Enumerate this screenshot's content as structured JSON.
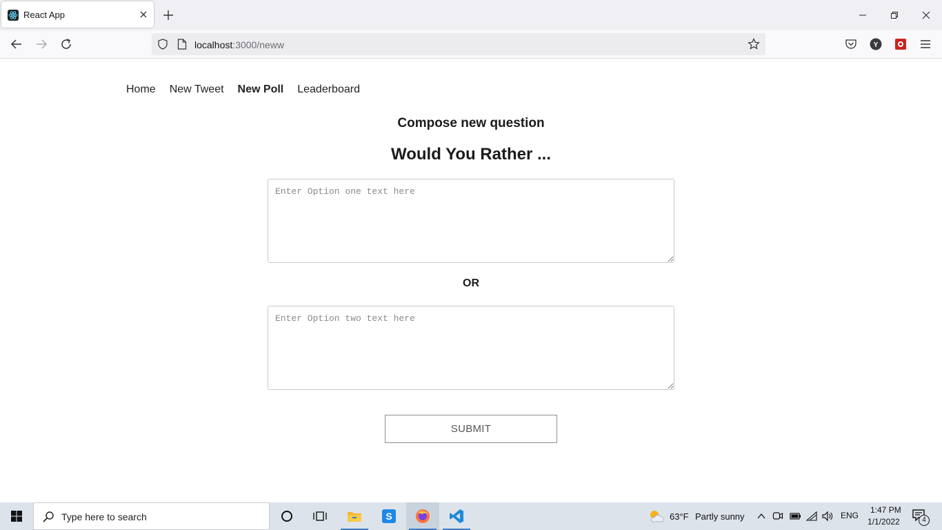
{
  "browser": {
    "tab_title": "React App",
    "url_host": "localhost",
    "url_path": ":3000/neww"
  },
  "app": {
    "nav": [
      "Home",
      "New Tweet",
      "New Poll",
      "Leaderboard"
    ],
    "active_nav": "New Poll",
    "compose_title": "Compose new question",
    "would_you_rather": "Would You Rather ...",
    "option_one_placeholder": "Enter Option one text here",
    "option_two_placeholder": "Enter Option two text here",
    "or_label": "OR",
    "submit_label": "SUBMIT"
  },
  "taskbar": {
    "search_placeholder": "Type here to search",
    "weather_temp": "63°F",
    "weather_text": "Partly sunny",
    "language": "ENG",
    "time": "1:47 PM",
    "date": "1/1/2022",
    "notification_count": "4"
  },
  "colors": {
    "accent": "#3b78c4",
    "text": "#1b1b1b"
  }
}
